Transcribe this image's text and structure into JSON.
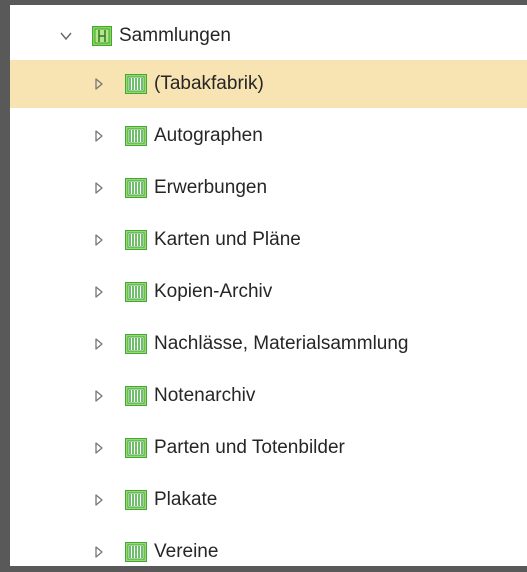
{
  "tree": {
    "root": {
      "label": "Sammlungen",
      "expanded": true,
      "toggle_icon": "caret-down-icon",
      "icon": "collection-folder-icon"
    },
    "children": [
      {
        "label": "(Tabakfabrik)",
        "selected": true
      },
      {
        "label": "Autographen"
      },
      {
        "label": "Erwerbungen"
      },
      {
        "label": "Karten und Pläne"
      },
      {
        "label": "Kopien-Archiv"
      },
      {
        "label": "Nachlässe, Materialsammlung"
      },
      {
        "label": "Notenarchiv"
      },
      {
        "label": "Parten und Totenbilder"
      },
      {
        "label": "Plakate"
      },
      {
        "label": "Vereine"
      }
    ],
    "child_toggle_icon": "caret-right-icon",
    "child_icon": "archive-series-icon",
    "selected_color": "#f8e3b2",
    "icon_color": "#3ea83b"
  }
}
